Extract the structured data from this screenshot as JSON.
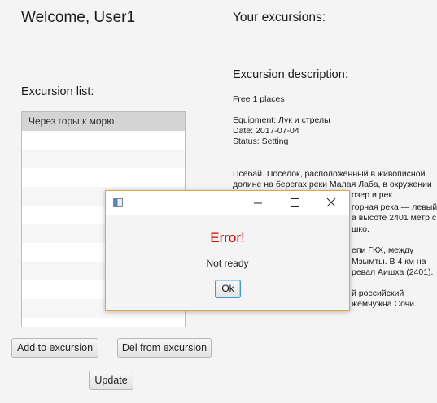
{
  "welcome": "Welcome, User1",
  "your_excursions": "Your excursions:",
  "excursion_list": {
    "label": "Excursion list:",
    "items": [
      "Через горы к морю",
      "",
      "",
      "",
      "",
      "",
      "",
      "",
      "",
      "",
      ""
    ]
  },
  "buttons": {
    "add": "Add to excursion",
    "del": "Del from excursion",
    "update": "Update"
  },
  "description": {
    "title": "Excursion description:",
    "free": "Free 1 places",
    "equipment": "Equipment: Лук и стрелы",
    "date": "Date: 2017-07-04",
    "status": "Status: Setting",
    "lines": [
      "Псебай. Поселок, расположенный в живописной",
      "долине на берегах реки Малая Лаба, в окружении",
      "озер и рек.",
      "горная река — левый",
      "а высоте 2401 метр с",
      "шко.",
      "",
      "епи ГКХ, между",
      "Мзымты. В 4 км на",
      "ревал Аишха (2401).",
      "",
      "й российский",
      "жемчужна Сочи."
    ]
  },
  "dialog": {
    "error": "Error!",
    "message": "Not ready",
    "ok": "Ok"
  },
  "colors": {
    "error_red": "#d40000",
    "dialog_border": "#e1a546",
    "focus_blue": "#3c9bd9"
  }
}
